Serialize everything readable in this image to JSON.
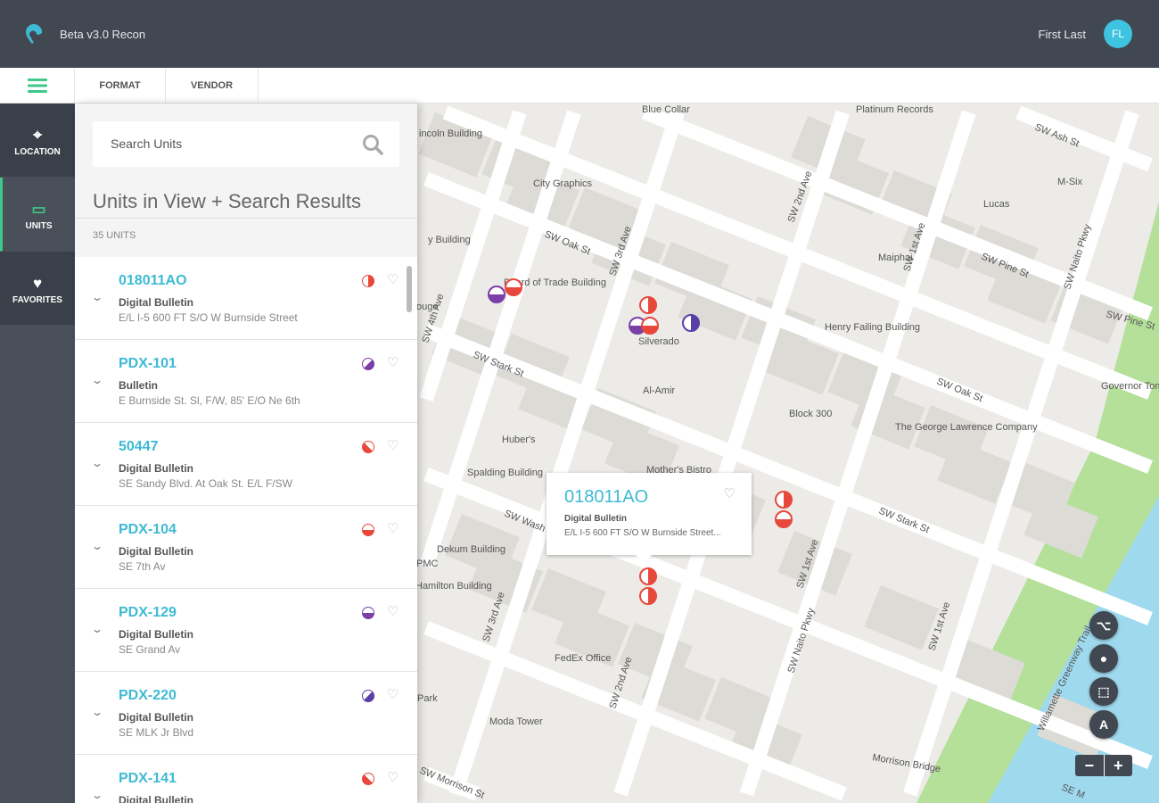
{
  "header": {
    "app_title": "Beta v3.0 Recon",
    "user_name": "First Last",
    "avatar_initials": "FL"
  },
  "toolbar": {
    "tabs": [
      {
        "label": "FORMAT"
      },
      {
        "label": "VENDOR"
      }
    ]
  },
  "nav": [
    {
      "label": "LOCATION",
      "icon": "map-icon"
    },
    {
      "label": "UNITS",
      "icon": "billboard-icon",
      "active": true
    },
    {
      "label": "FAVORITES",
      "icon": "favorites-folder-icon"
    }
  ],
  "panel": {
    "search_placeholder": "Search Units",
    "title": "Units in View + Search Results",
    "count": "35 UNITS",
    "items": [
      {
        "id": "018011AO",
        "format": "Digital Bulletin",
        "address": "E/L I-5 600 FT S/O W Burnside Street",
        "color": "#e8483b",
        "fill": "right"
      },
      {
        "id": "PDX-101",
        "format": "Bulletin",
        "address": "E Burnside St. Sl, F/W, 85' E/O Ne 6th",
        "color": "#7b3fa8",
        "fill": "bottom-right"
      },
      {
        "id": "50447",
        "format": "Digital Bulletin",
        "address": "SE Sandy Blvd. At Oak St. E/L F/SW",
        "color": "#e8483b",
        "fill": "bottom-left"
      },
      {
        "id": "PDX-104",
        "format": "Digital Bulletin",
        "address": "SE 7th Av",
        "color": "#e8483b",
        "fill": "bottom"
      },
      {
        "id": "PDX-129",
        "format": "Digital Bulletin",
        "address": "SE Grand Av",
        "color": "#7b3fa8",
        "fill": "bottom"
      },
      {
        "id": "PDX-220",
        "format": "Digital Bulletin",
        "address": "SE MLK Jr Blvd",
        "color": "#5a3fa8",
        "fill": "bottom-right"
      },
      {
        "id": "PDX-141",
        "format": "Digital Bulletin",
        "address": "",
        "color": "#e8483b",
        "fill": "bottom-left"
      }
    ]
  },
  "popup": {
    "id": "018011AO",
    "format": "Digital Bulletin",
    "address": "E/L I-5 600 FT S/O W Burnside Street..."
  },
  "map": {
    "labels": [
      "Blue Collar",
      "Platinum Records",
      "SW Ash St",
      "incoln Building",
      "City Graphics",
      "M-Six",
      "Lucas",
      "SW 2nd Ave",
      "y Building",
      "SW Oak St",
      "SW 3rd Ave",
      "Maiphai",
      "SW 1st Ave",
      "SW Pine St",
      "SW Naito Pkwy",
      "Board of Trade Building",
      "ouge",
      "SW 4th Ave",
      "Silverado",
      "Henry Failing Building",
      "SW Stark St",
      "Al-Amir",
      "SW Oak St",
      "Governor Tom McCall Waterfront Park",
      "Block 300",
      "The George Lawrence Company",
      "Huber's",
      "Spalding Building",
      "Mother's Bistro",
      "SW Wash",
      "SW Stark St",
      "Dekum Building",
      "PMC",
      "Hamilton Building",
      "SW 3rd Ave",
      "SW 1st Ave",
      "SW Naito Pkwy",
      "SW 1st Ave",
      "FedEx Office",
      "SW 2nd Ave",
      "Willamette Greenway Trail",
      "Park",
      "Moda Tower",
      "Morrison Bridge",
      "SW Morrison St",
      "SE M",
      "SW Pine St"
    ],
    "zoom_out": "−",
    "zoom_in": "+"
  }
}
